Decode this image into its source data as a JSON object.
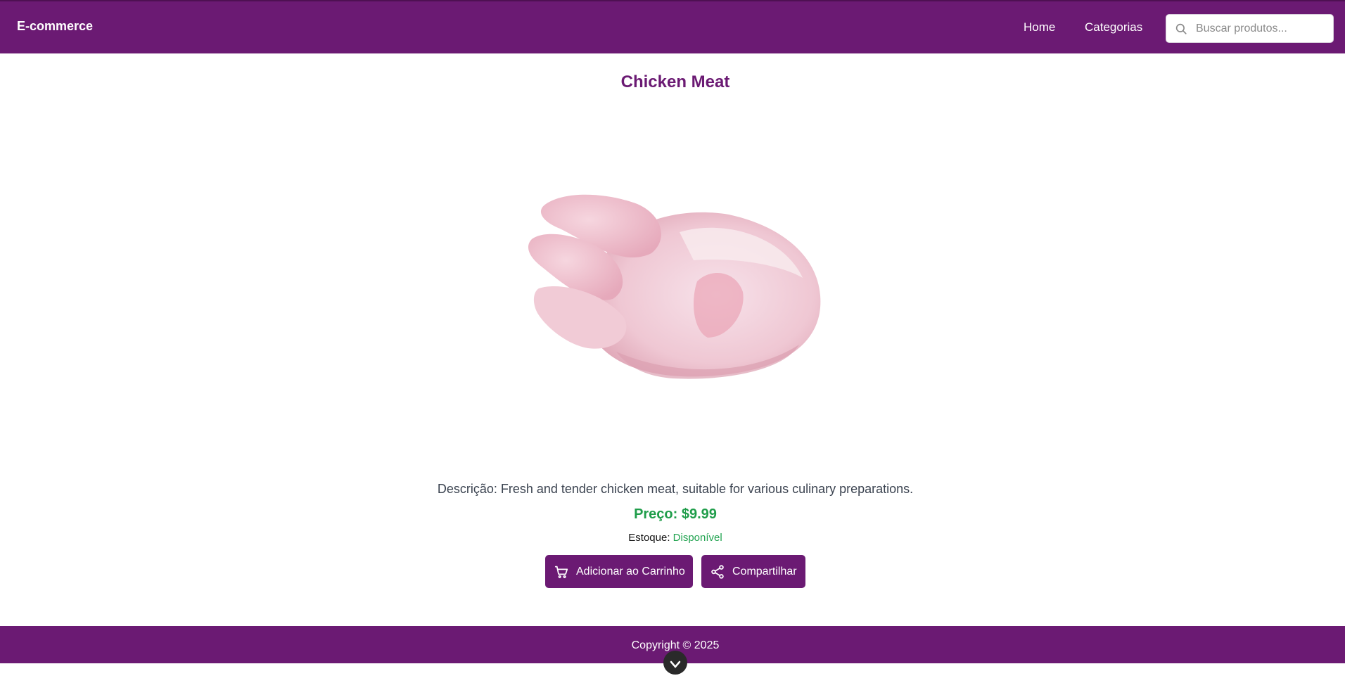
{
  "navbar": {
    "brand": "E-commerce",
    "links": [
      "Home",
      "Categorias"
    ],
    "search": {
      "placeholder": "Buscar produtos...",
      "value": ""
    },
    "background_color": "#6b1a73"
  },
  "product": {
    "name": "Chicken Meat",
    "description": "Descrição: Fresh and tender chicken meat, suitable for various culinary preparations.",
    "price": "Preço: $9.99",
    "stock_label": "Estoque:",
    "stock_status": "Disponível",
    "image_icon": "raw-chicken-image",
    "actions": {
      "add_to_cart": "Adicionar ao Carrinho",
      "share": "Compartilhar"
    }
  },
  "footer": {
    "copyright": "Copyright © 2025",
    "floating_badge_icon": "x-badge-icon"
  },
  "colors": {
    "brand_purple": "#6b1a73",
    "price_green": "#1f9d4a",
    "stock_green": "#21a350"
  }
}
